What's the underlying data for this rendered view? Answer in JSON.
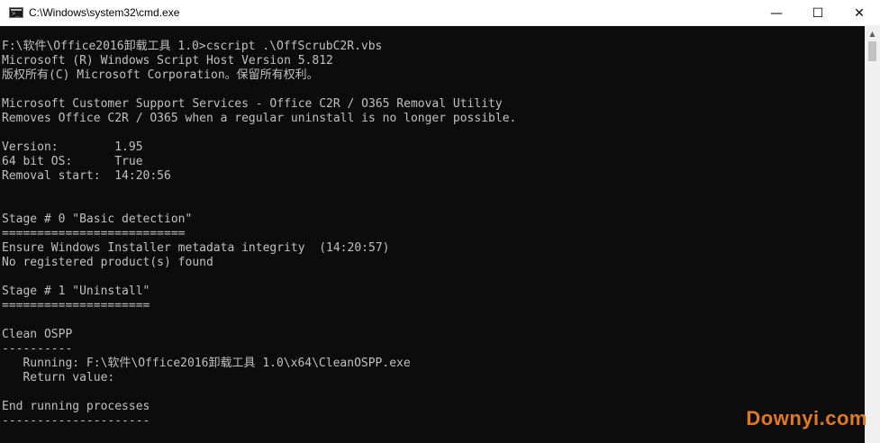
{
  "window": {
    "title": "C:\\Windows\\system32\\cmd.exe",
    "icon": "cmd-icon",
    "controls": {
      "minimize": "—",
      "maximize": "☐",
      "close": "✕"
    }
  },
  "console": {
    "lines": [
      "F:\\软件\\Office2016卸载工具 1.0>cscript .\\OffScrubC2R.vbs",
      "Microsoft (R) Windows Script Host Version 5.812",
      "版权所有(C) Microsoft Corporation。保留所有权利。",
      "",
      "Microsoft Customer Support Services - Office C2R / O365 Removal Utility",
      "Removes Office C2R / O365 when a regular uninstall is no longer possible.",
      "",
      "Version:        1.95",
      "64 bit OS:      True",
      "Removal start:  14:20:56",
      "",
      "",
      "Stage # 0 \"Basic detection\"",
      "==========================",
      "Ensure Windows Installer metadata integrity  (14:20:57)",
      "No registered product(s) found",
      "",
      "Stage # 1 \"Uninstall\"",
      "=====================",
      "",
      "Clean OSPP",
      "----------",
      "   Running: F:\\软件\\Office2016卸载工具 1.0\\x64\\CleanOSPP.exe",
      "   Return value:",
      "",
      "End running processes",
      "---------------------"
    ]
  },
  "watermark": {
    "text": "Downyi.com",
    "color": "#e07a1f"
  },
  "colors": {
    "console_bg": "#0c0c0c",
    "console_fg": "#c0c0c0"
  }
}
